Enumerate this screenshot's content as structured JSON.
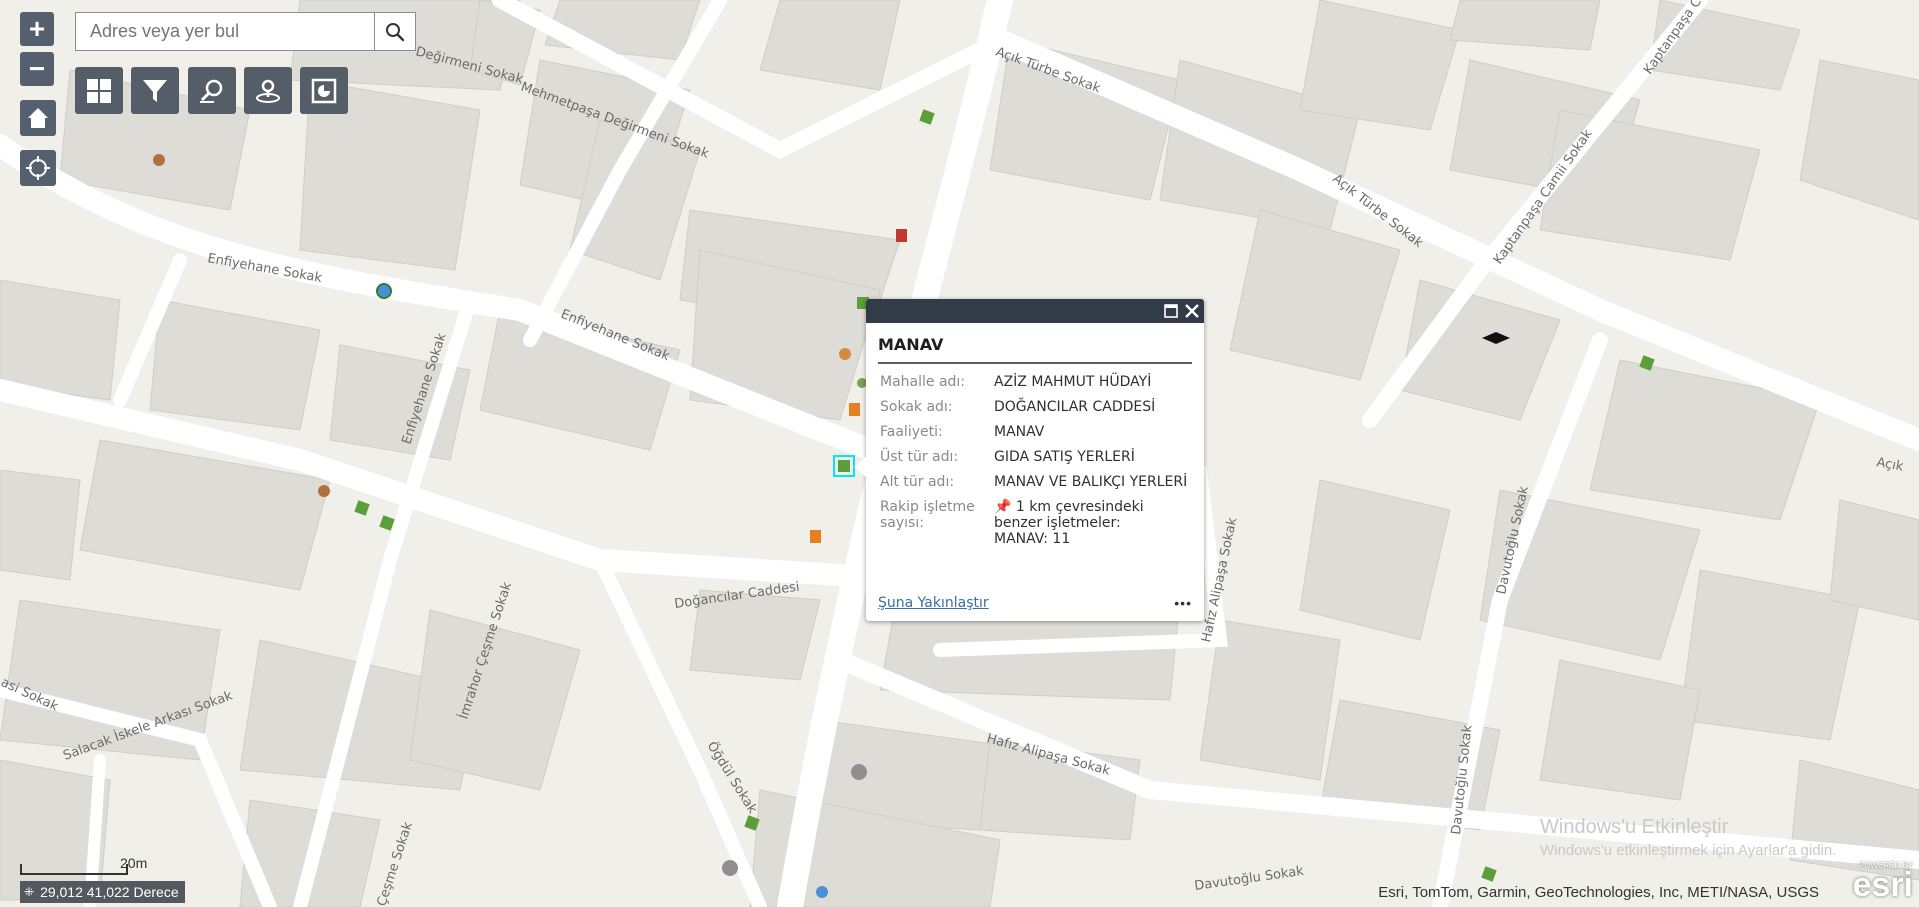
{
  "search": {
    "placeholder": "Adres veya yer bul"
  },
  "controls": {
    "zoom_in": "+",
    "zoom_out": "−"
  },
  "toolbar_icons": [
    "grid-icon",
    "filter-icon",
    "query-icon",
    "locate-icon",
    "report-icon"
  ],
  "streets": [
    "Mehmetpaşa Değirmeni Sokak",
    "Değirmeni Sokak",
    "Doğancılar Caddesi",
    "Açık Türbe Sokak",
    "Enfiyehane Sokak",
    "Kaptanpaşa Camii Sokak",
    "Davutoğlu Sokak",
    "Hafız Alipaşa Sokak",
    "İmrahor Çeşme Sokak",
    "Salacak İskele Arkası Sokak",
    "Öğdül Sokak",
    "Çeşme Sokak",
    "Açık",
    "Kaptanpaşa Cami",
    "asi Sokak"
  ],
  "popup": {
    "title": "MANAV",
    "rows": [
      {
        "label": "Mahalle adı:",
        "value": "AZİZ MAHMUT HÜDAYİ"
      },
      {
        "label": "Sokak adı:",
        "value": "DOĞANCILAR CADDESİ"
      },
      {
        "label": "Faaliyeti:",
        "value": "MANAV"
      },
      {
        "label": "Üst tür adı:",
        "value": "GIDA SATIŞ YERLERİ"
      },
      {
        "label": "Alt tür adı:",
        "value": "MANAV VE BALIKÇI YERLERİ"
      }
    ],
    "competitor_label": "Rakip işletme sayısı:",
    "competitor_value_line1": "1 km çevresindeki benzer işletmeler:",
    "competitor_value_line2": "MANAV: 11",
    "zoom_link": "Şuna Yakınlaştır",
    "more": "•••"
  },
  "coordinates": "29,012 41,022 Derece",
  "scale_label": "20m",
  "attribution": "Esri, TomTom, Garmin, GeoTechnologies, Inc, METI/NASA, USGS",
  "watermark": {
    "line1": "Windows'u Etkinleştir",
    "line2": "Windows'u etkinleştirmek için Ayarlar'a gidin."
  },
  "logo": {
    "powered": "POWERED BY",
    "name": "esri"
  },
  "colors": {
    "map_bg": "#f0efe9",
    "building": "#dedcd6",
    "road": "#ffffff",
    "control": "#55606e",
    "popup_header": "#323c48",
    "selection": "#00e5ff"
  }
}
